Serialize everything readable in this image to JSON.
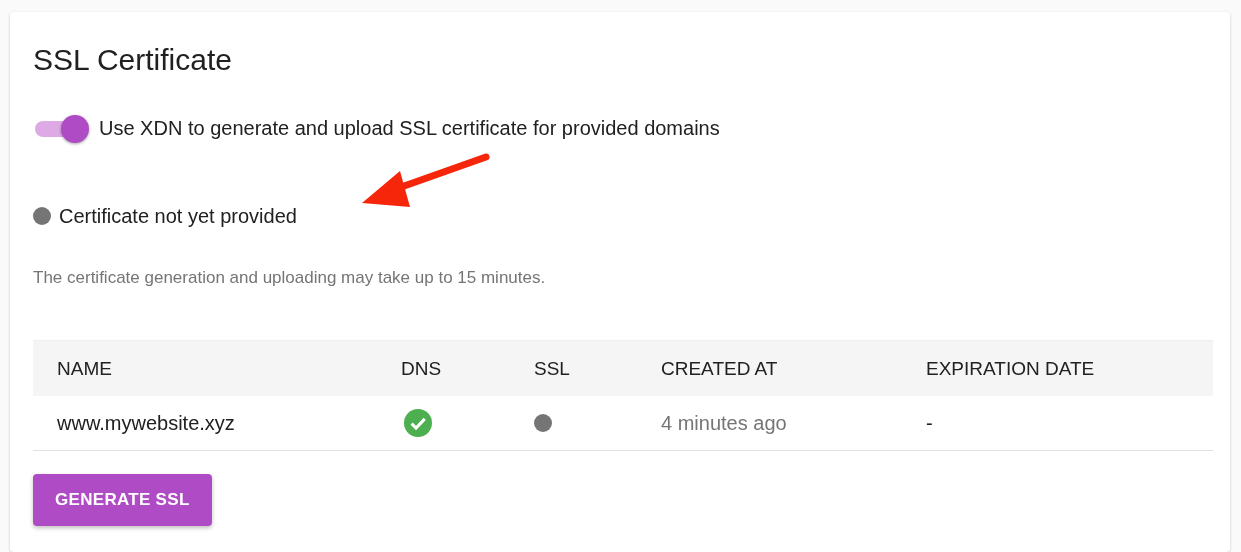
{
  "card": {
    "title": "SSL Certificate"
  },
  "toggle": {
    "label": "Use XDN to generate and upload SSL certificate for provided domains",
    "on": true
  },
  "status": {
    "text": "Certificate not yet provided",
    "color": "#757575"
  },
  "annotation": {
    "kind": "arrow"
  },
  "note": "The certificate generation and uploading may take up to 15 minutes.",
  "table": {
    "columns": [
      "NAME",
      "DNS",
      "SSL",
      "CREATED AT",
      "EXPIRATION DATE"
    ],
    "rows": [
      {
        "cells": [
          {
            "kind": "text",
            "text": "www.mywebsite.xyz"
          },
          {
            "kind": "check"
          },
          {
            "kind": "dot",
            "color": "#757575"
          },
          {
            "kind": "muted",
            "text": "4 minutes ago"
          },
          {
            "kind": "text",
            "text": "-"
          }
        ]
      }
    ]
  },
  "buttons": [
    "GENERATE SSL"
  ]
}
